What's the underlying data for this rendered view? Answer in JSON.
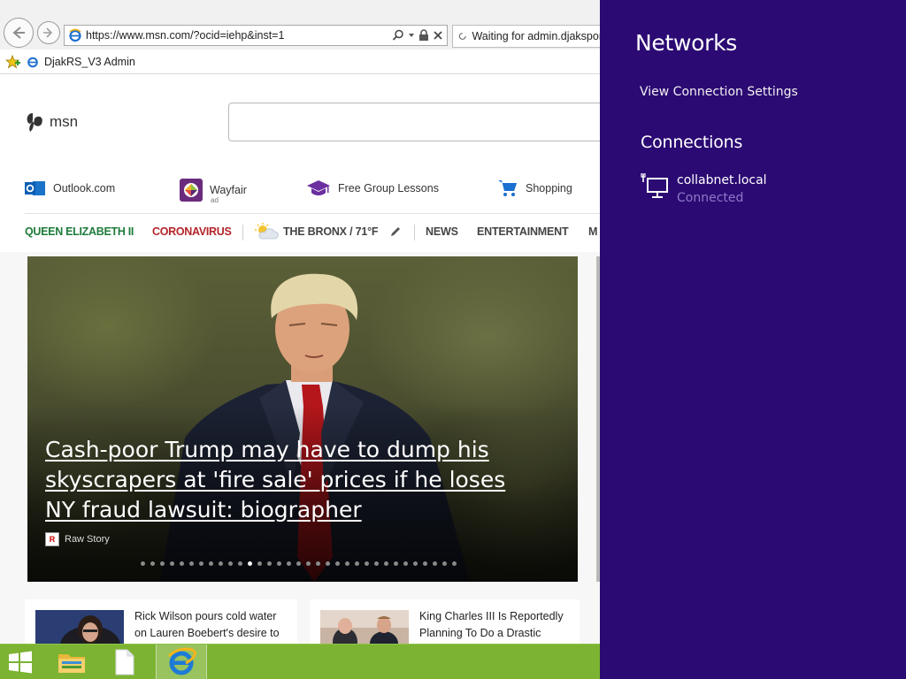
{
  "browser": {
    "url": "https://www.msn.com/?ocid=iehp&inst=1",
    "tab_title": "Waiting for admin.djakspor",
    "favorite_label": "DjakRS_V3 Admin"
  },
  "msn": {
    "logo_text": "msn",
    "quicklinks": [
      {
        "label": "Outlook.com",
        "icon": "outlook-icon"
      },
      {
        "label": "Wayfair",
        "icon": "wayfair-icon",
        "badge": "ad"
      },
      {
        "label": "Free Group Lessons",
        "icon": "graduation-cap-icon"
      },
      {
        "label": "Shopping",
        "icon": "shopping-cart-icon"
      }
    ],
    "topics": {
      "queen": "QUEEN ELIZABETH II",
      "coronavirus": "CORONAVIRUS",
      "weather": "THE BRONX / 71°F",
      "news": "NEWS",
      "entertainment": "ENTERTAINMENT",
      "more": "M"
    },
    "hero": {
      "headline": "Cash-poor Trump may have to dump his skyscrapers at 'fire sale' prices if he loses NY fraud lawsuit: biographer",
      "source": "Raw Story",
      "source_logo": "R",
      "slide_count": 33,
      "active_slide": 11
    },
    "cards": [
      {
        "text": "Rick Wilson pours cold water on Lauren Boebert's desire to"
      },
      {
        "text": "King Charles III Is Reportedly Planning To Do a Drastic"
      }
    ]
  },
  "charm": {
    "title": "Networks",
    "view_settings": "View Connection Settings",
    "connections_title": "Connections",
    "network_name": "collabnet.local",
    "network_status": "Connected"
  },
  "colors": {
    "charm_bg": "#2b0a73",
    "taskbar_bg": "#7cb332",
    "topic_green": "#1e7b3b",
    "topic_red": "#b4252a",
    "status_purple": "#8e79c9"
  }
}
